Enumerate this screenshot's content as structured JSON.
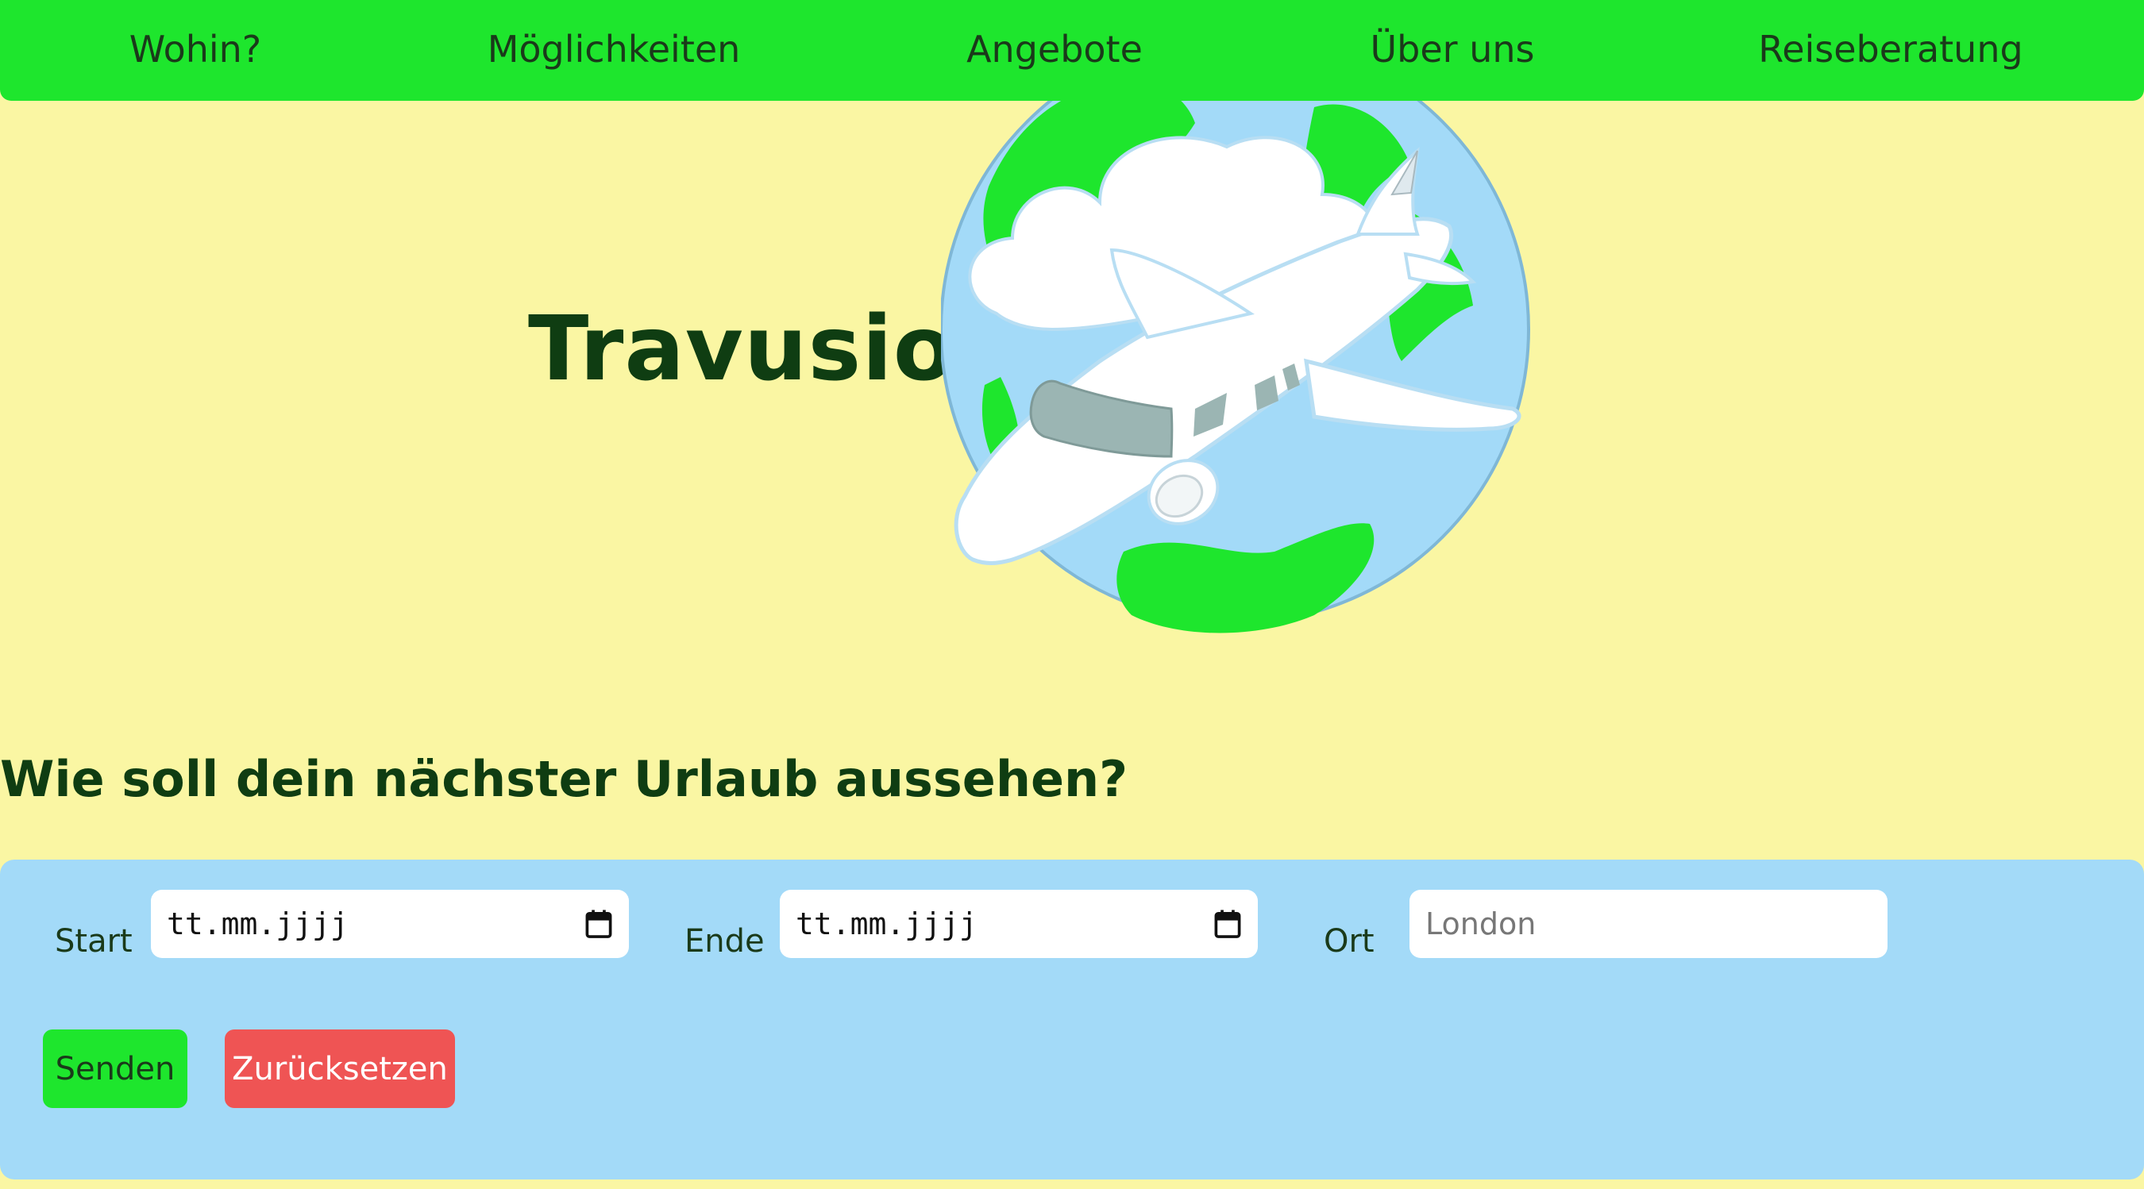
{
  "nav": {
    "items": [
      "Wohin?",
      "Möglichkeiten",
      "Angebote",
      "Über uns",
      "Reiseberatung"
    ]
  },
  "hero": {
    "brand": "Travusion",
    "logo_icon": "globe-airplane-icon"
  },
  "headline": "Wie soll dein nächster Urlaub aussehen?",
  "form": {
    "start_label": "Start",
    "start_value": "tt.mm.jjjj",
    "end_label": "Ende",
    "end_value": "tt.mm.jjjj",
    "place_label": "Ort",
    "place_placeholder": "London",
    "calendar_icon": "calendar-icon",
    "send_label": "Senden",
    "reset_label": "Zurücksetzen"
  },
  "colors": {
    "nav_bg": "#1ee62d",
    "page_bg": "#faf6a3",
    "form_bg": "#a3daf8",
    "text_dark": "#0f3d12",
    "send_button": "#1ee62d",
    "reset_button": "#ef5454"
  }
}
